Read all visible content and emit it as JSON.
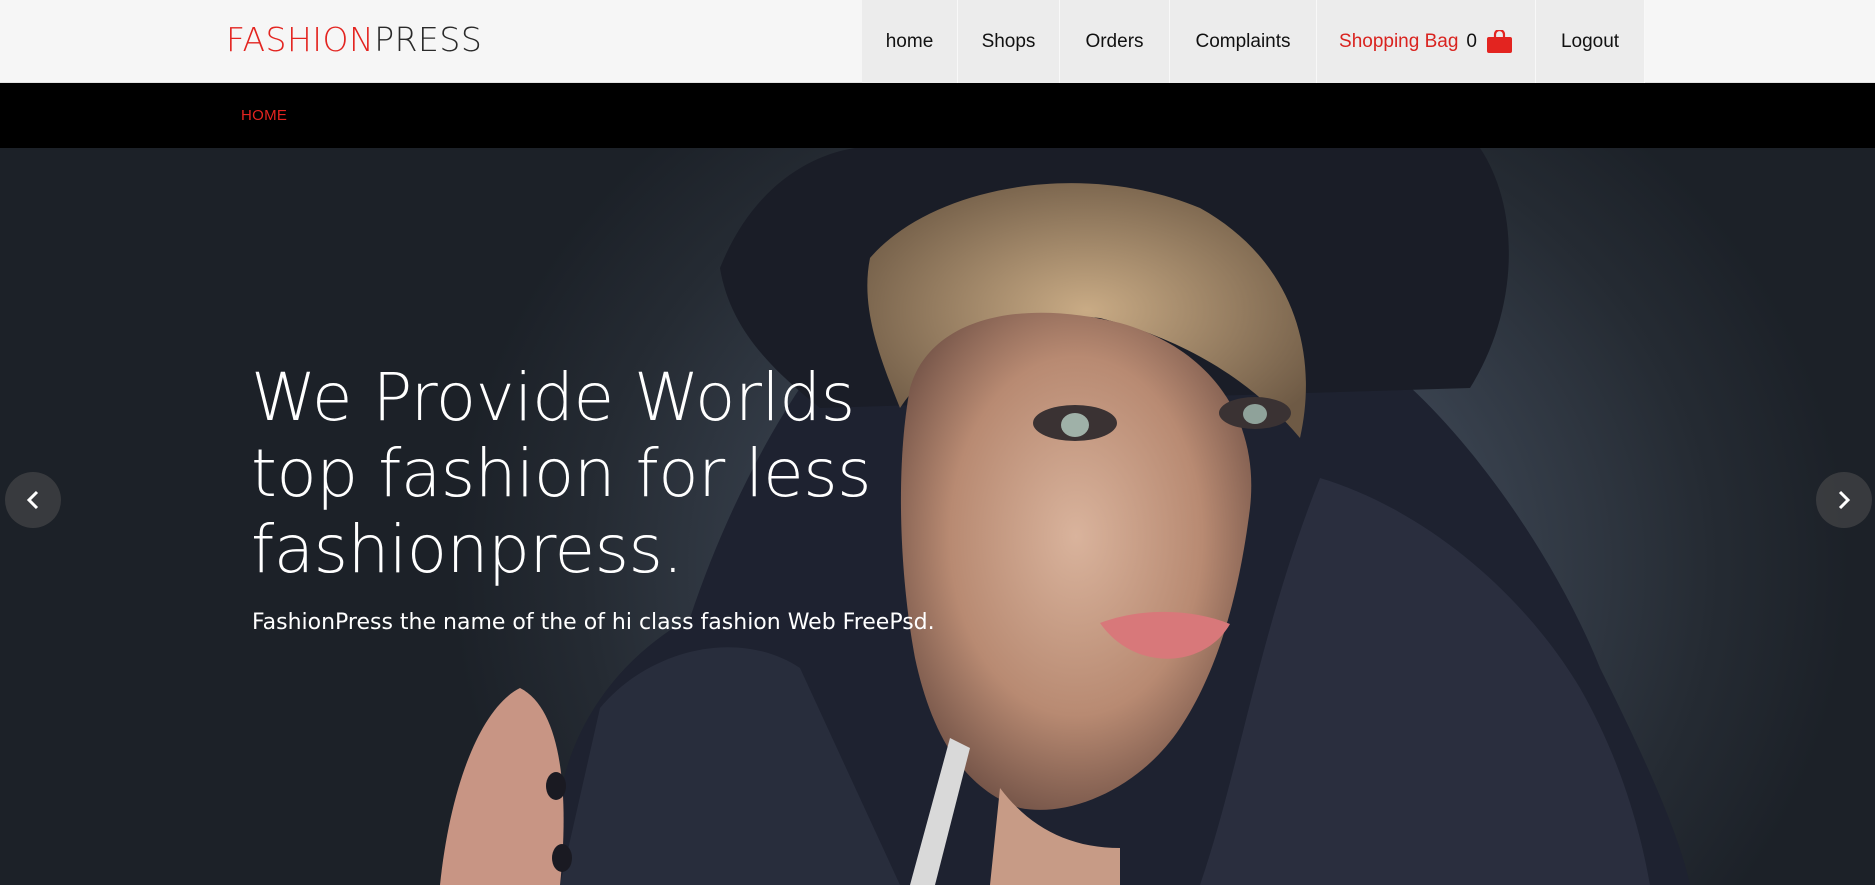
{
  "logo": {
    "part1": "FASHION",
    "part2": "PRESS"
  },
  "nav": {
    "home": "home",
    "shops": "Shops",
    "orders": "Orders",
    "complaints": "Complaints",
    "bag_label": "Shopping Bag",
    "bag_count": "0",
    "logout": "Logout"
  },
  "breadcrumb": {
    "current": "HOME"
  },
  "hero": {
    "headline_lines": [
      "We Provide Worlds",
      "top fashion for less",
      "fashionpress."
    ],
    "subline": "FashionPress the name of the of hi class fashion Web FreePsd."
  },
  "colors": {
    "accent": "#e32420",
    "nav_bg": "#ececec",
    "header_bg": "#f6f6f6",
    "crumb_bar": "#000000"
  },
  "icons": {
    "bag": "shopping-bag-icon",
    "prev": "chevron-left-icon",
    "next": "chevron-right-icon"
  }
}
